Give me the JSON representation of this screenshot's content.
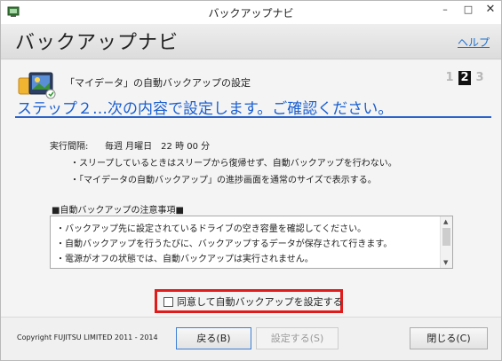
{
  "window": {
    "title": "バックアップナビ",
    "minimize_glyph": "–",
    "maximize_glyph": "□",
    "close_glyph": "✕"
  },
  "header": {
    "app_title": "バックアップナビ",
    "help_link": "ヘルプ"
  },
  "task": {
    "label": "「マイデータ」の自動バックアップの設定",
    "icon": "photo-folder-icon"
  },
  "steps": {
    "numbers": [
      "1",
      "2",
      "3"
    ],
    "current": "2"
  },
  "step_heading": "ステップ２…次の内容で設定します。ご確認ください。",
  "schedule": {
    "label": "実行間隔:",
    "value": "毎週 月曜日　22 時 00 分"
  },
  "notes": [
    "・スリープしているときはスリープから復帰せず、自動バックアップを行わない。",
    "・「マイデータの自動バックアップ」の進捗画面を通常のサイズで表示する。"
  ],
  "caution": {
    "title": "■自動バックアップの注意事項■",
    "lines": [
      "・バックアップ先に設定されているドライブの空き容量を確認してください。",
      "・自動バックアップを行うたびに、バックアップするデータが保存されて行きます。",
      "・電源がオフの状態では、自動バックアップは実行されません。"
    ]
  },
  "agree": {
    "label": "同意して自動バックアップを設定する",
    "checked": false,
    "highlight_color": "#e01b1b"
  },
  "footer": {
    "copyright": "Copyright FUJITSU LIMITED 2011 - 2014",
    "back_button": "戻る(B)",
    "set_button": "設定する(S)",
    "close_button": "閉じる(C)"
  },
  "colors": {
    "accent": "#1a5fd0",
    "link": "#1a6fd0",
    "disabled_text": "#9a9a9a"
  }
}
